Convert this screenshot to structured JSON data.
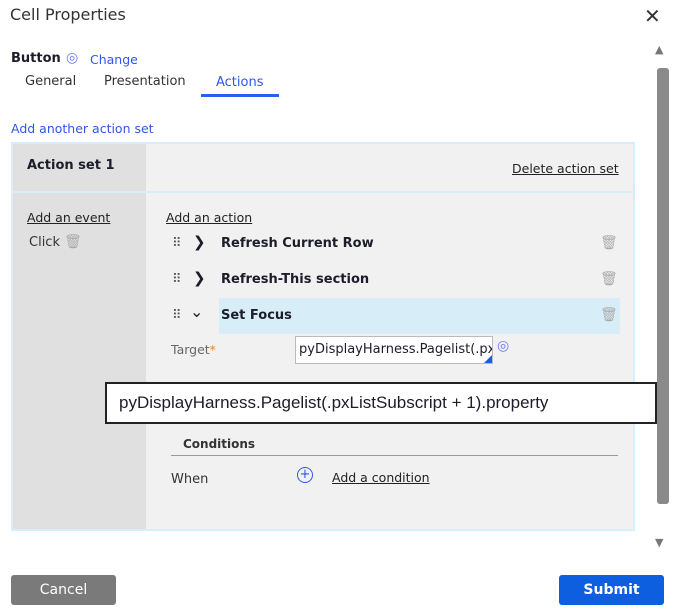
{
  "dialog": {
    "title": "Cell Properties"
  },
  "control": {
    "type": "Button",
    "change_label": "Change"
  },
  "tabs": [
    {
      "label": "General"
    },
    {
      "label": "Presentation"
    },
    {
      "label": "Actions",
      "active": true
    }
  ],
  "add_action_set": "Add another action set",
  "action_set": {
    "title": "Action set 1",
    "delete_label": "Delete action set",
    "add_event": "Add an event",
    "event": "Click",
    "add_action": "Add an action",
    "actions": [
      {
        "label": "Refresh Current Row",
        "expanded": false
      },
      {
        "label": "Refresh-This section",
        "expanded": false
      },
      {
        "label": "Set Focus",
        "expanded": true
      }
    ],
    "target_label": "Target",
    "required_mark": "*",
    "target_value": "pyDisplayHarness.Pagelist(.pxListSubscript + 1).property",
    "conditions_title": "Conditions",
    "when_label": "When",
    "add_condition": "Add a condition"
  },
  "tooltip": "pyDisplayHarness.Pagelist(.pxListSubscript + 1).property",
  "footer": {
    "cancel": "Cancel",
    "submit": "Submit"
  },
  "colors": {
    "accent": "#3056e8",
    "submit": "#0d5fe0",
    "highlight": "#d7eef8"
  }
}
